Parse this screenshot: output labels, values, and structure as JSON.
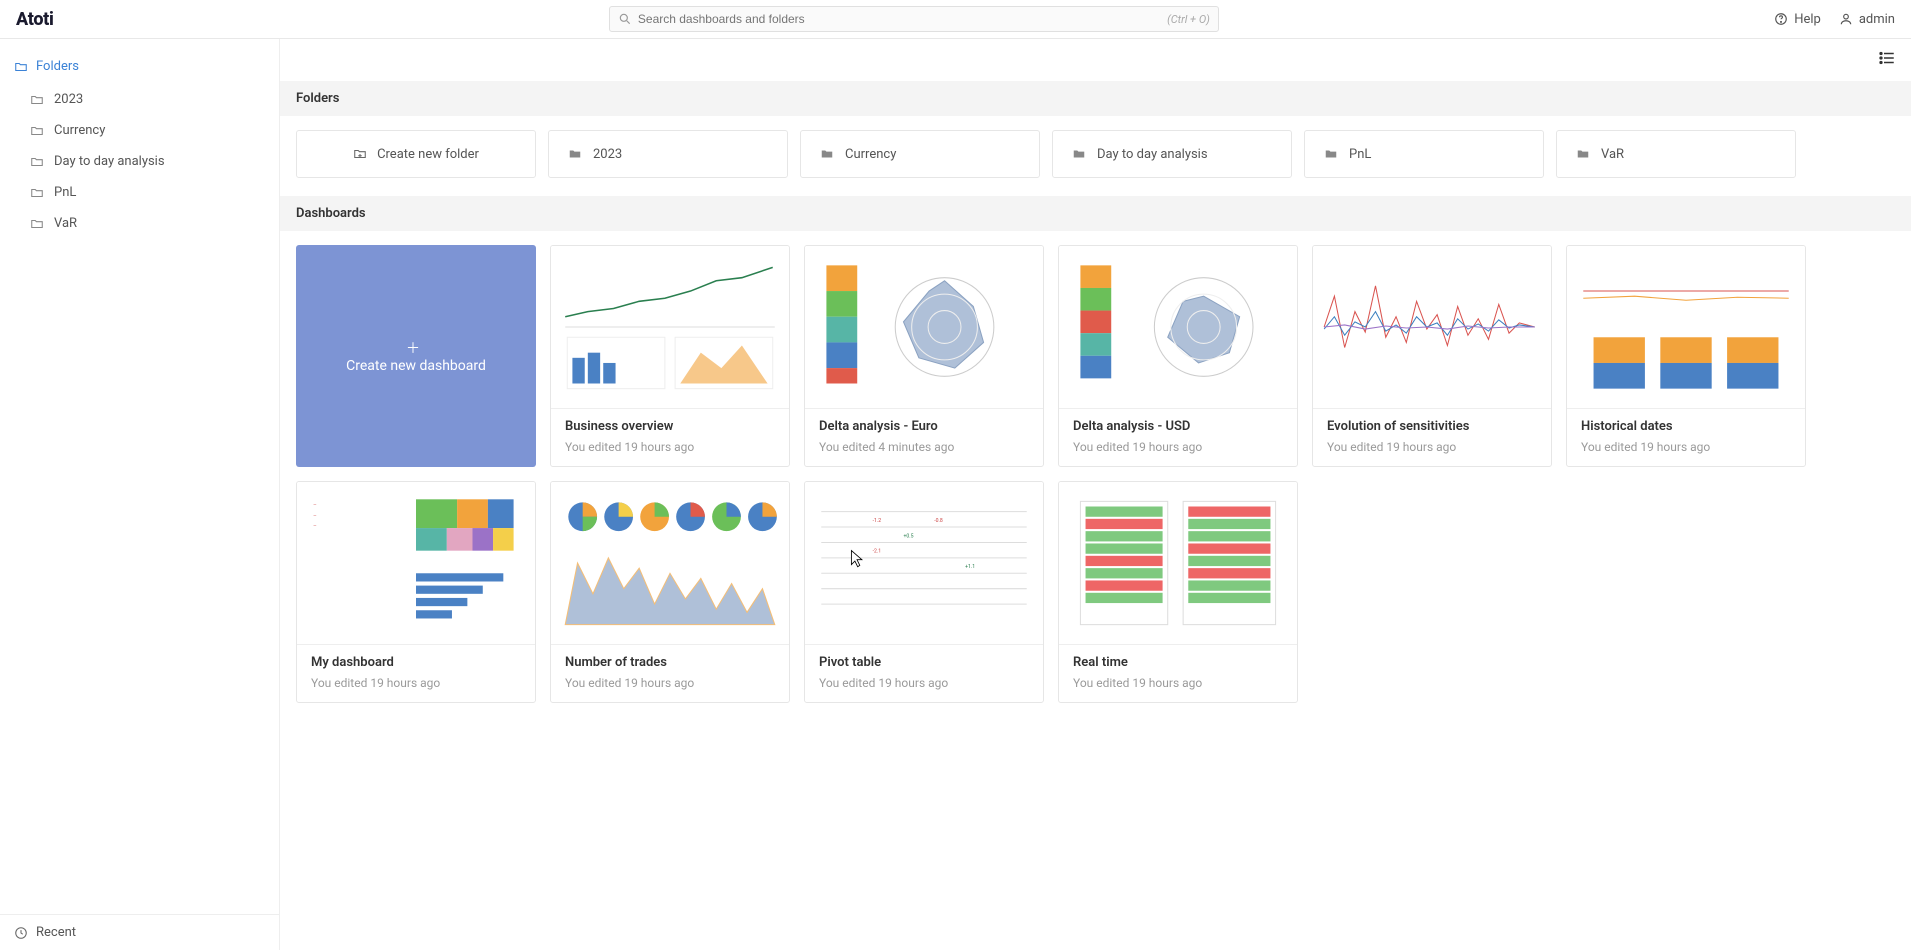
{
  "brand": "Atoti",
  "search": {
    "placeholder": "Search dashboards and folders",
    "hint": "(Ctrl + O)"
  },
  "top": {
    "help": "Help",
    "user": "admin"
  },
  "sidebar": {
    "root": "Folders",
    "items": [
      {
        "label": "2023"
      },
      {
        "label": "Currency"
      },
      {
        "label": "Day to day analysis"
      },
      {
        "label": "PnL"
      },
      {
        "label": "VaR"
      }
    ],
    "recent": "Recent"
  },
  "sections": {
    "folders": "Folders",
    "dashboards": "Dashboards"
  },
  "create_folder": "Create new folder",
  "folder_cards": [
    {
      "label": "2023"
    },
    {
      "label": "Currency"
    },
    {
      "label": "Day to day analysis"
    },
    {
      "label": "PnL"
    },
    {
      "label": "VaR"
    }
  ],
  "create_dashboard": "Create new dashboard",
  "dashboards_row1": [
    {
      "title": "Business overview",
      "sub": "You edited 19 hours ago"
    },
    {
      "title": "Delta analysis - Euro",
      "sub": "You edited 4 minutes ago"
    },
    {
      "title": "Delta analysis - USD",
      "sub": "You edited 19 hours ago"
    },
    {
      "title": "Evolution of sensitivities",
      "sub": "You edited 19 hours ago"
    },
    {
      "title": "Historical dates",
      "sub": "You edited 19 hours ago"
    }
  ],
  "dashboards_row2": [
    {
      "title": "My dashboard",
      "sub": "You edited 19 hours ago"
    },
    {
      "title": "Number of trades",
      "sub": "You edited 19 hours ago"
    },
    {
      "title": "Pivot table",
      "sub": "You edited 19 hours ago"
    },
    {
      "title": "Real time",
      "sub": "You edited 19 hours ago"
    }
  ]
}
